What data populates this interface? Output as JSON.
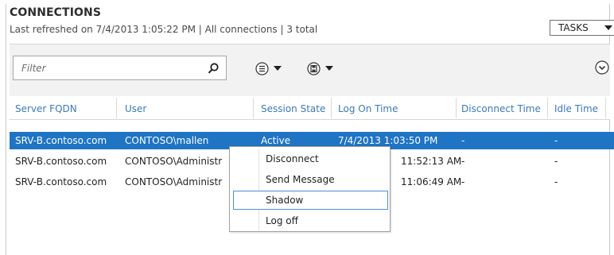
{
  "header": {
    "title": "CONNECTIONS",
    "subtitle": "Last refreshed on 7/4/2013 1:05:22 PM | All connections  | 3 total",
    "tasks_label": "TASKS"
  },
  "toolbar": {
    "filter_placeholder": "Filter",
    "icons": [
      "search-icon",
      "list-view-icon",
      "save-icon",
      "expand-icon"
    ]
  },
  "table": {
    "columns": [
      "Server FQDN",
      "User",
      "Session State",
      "Log On Time",
      "Disconnect Time",
      "Idle Time"
    ],
    "rows": [
      {
        "server": "SRV-B.contoso.com",
        "user": "CONTOSO\\mallen",
        "state": "Active",
        "logon": "7/4/2013 1:03:50 PM",
        "disconnect": "-",
        "idle": "-",
        "selected": true
      },
      {
        "server": "SRV-B.contoso.com",
        "user": "CONTOSO\\Administr",
        "state": "",
        "logon": "11:52:13 AM",
        "disconnect": "-",
        "idle": "-",
        "selected": false
      },
      {
        "server": "SRV-B.contoso.com",
        "user": "CONTOSO\\Administr",
        "state": "",
        "logon": "11:06:49 AM",
        "disconnect": "-",
        "idle": "-",
        "selected": false
      }
    ]
  },
  "context_menu": {
    "items": [
      "Disconnect",
      "Send Message",
      "Shadow",
      "Log off"
    ],
    "highlighted": "Shadow"
  },
  "colors": {
    "selection": "#1f74c4",
    "header_text": "#3b7ab8",
    "menu_hover_border": "#4a8fd4"
  }
}
